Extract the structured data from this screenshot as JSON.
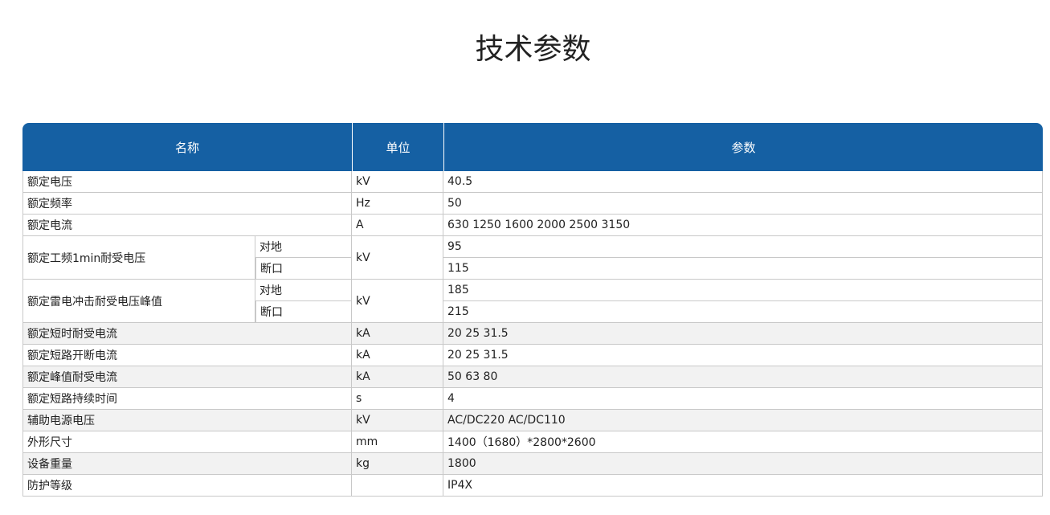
{
  "page": {
    "title": "技术参数"
  },
  "table": {
    "headers": {
      "name": "名称",
      "unit": "单位",
      "value": "参数"
    },
    "rows": [
      {
        "name": "额定电压",
        "unit": "kV",
        "value": "40.5"
      },
      {
        "name": "额定频率",
        "unit": "Hz",
        "value": "50"
      },
      {
        "name": "额定电流",
        "unit": "A",
        "value": "630 1250 1600 2000 2500 3150"
      },
      {
        "name": "额定工频1min耐受电压",
        "unit": "kV",
        "sub": [
          {
            "label": "对地",
            "value": "95"
          },
          {
            "label": "断口",
            "value": "115"
          }
        ]
      },
      {
        "name": "额定雷电冲击耐受电压峰值",
        "unit": "kV",
        "sub": [
          {
            "label": "对地",
            "value": "185"
          },
          {
            "label": "断口",
            "value": "215"
          }
        ]
      },
      {
        "name": "额定短时耐受电流",
        "unit": "kA",
        "value": "20 25 31.5"
      },
      {
        "name": "额定短路开断电流",
        "unit": "kA",
        "value": "20 25 31.5"
      },
      {
        "name": "额定峰值耐受电流",
        "unit": "kA",
        "value": "50 63 80"
      },
      {
        "name": "额定短路持续时间",
        "unit": "s",
        "value": "4"
      },
      {
        "name": "辅助电源电压",
        "unit": "kV",
        "value": "AC/DC220 AC/DC110"
      },
      {
        "name": "外形尺寸",
        "unit": "mm",
        "value": "1400（1680）*2800*2600"
      },
      {
        "name": "设备重量",
        "unit": "kg",
        "value": "1800"
      },
      {
        "name": "防护等级",
        "unit": "",
        "value": "IP4X"
      }
    ]
  },
  "colors": {
    "header_bg": "#1560a3",
    "header_text": "#ffffff",
    "border": "#c8c8c8",
    "shaded_row": "#f2f2f2"
  }
}
